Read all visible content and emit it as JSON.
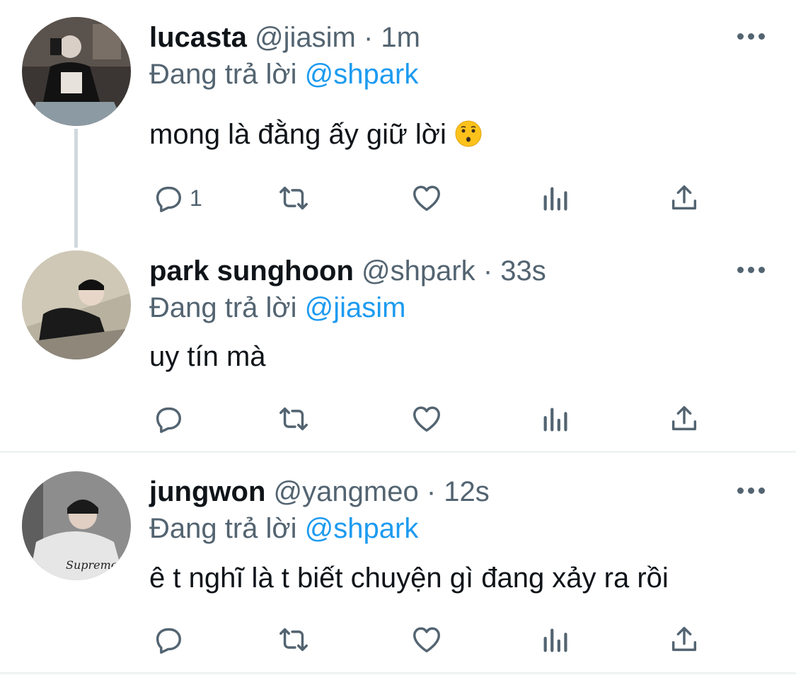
{
  "colors": {
    "text": "#0f1419",
    "secondary": "#536471",
    "link": "#1d9bf0",
    "divider": "#eff3f4",
    "thread": "#cfd9de"
  },
  "tweets": [
    {
      "name": "lucasta",
      "handle": "@jiasim",
      "sep": "·",
      "time": "1m",
      "replying_prefix": "Đang trả lời ",
      "replying_to": "@shpark",
      "text": "mong là đằng ấy giữ lời",
      "emoji": "kissing-face-icon",
      "reply_count": "1"
    },
    {
      "name": "park sunghoon",
      "handle": "@shpark",
      "sep": "·",
      "time": "33s",
      "replying_prefix": "Đang trả lời ",
      "replying_to": "@jiasim",
      "text": "uy tín mà",
      "reply_count": ""
    },
    {
      "name": "jungwon",
      "handle": "@yangmeo",
      "sep": "·",
      "time": "12s",
      "replying_prefix": "Đang trả lời ",
      "replying_to": "@shpark",
      "text": "ê t nghĩ là t biết chuyện gì đang xảy ra rồi",
      "reply_count": ""
    }
  ],
  "icons": [
    "reply-icon",
    "retweet-icon",
    "like-icon",
    "analytics-icon",
    "share-icon",
    "more-icon"
  ]
}
